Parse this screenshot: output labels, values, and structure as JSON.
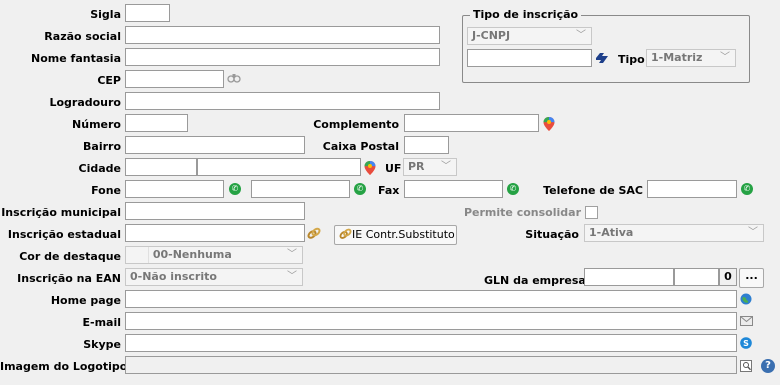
{
  "labels": {
    "sigla": "Sigla",
    "razao_social": "Razão social",
    "nome_fantasia": "Nome fantasia",
    "cep": "CEP",
    "logradouro": "Logradouro",
    "numero": "Número",
    "complemento": "Complemento",
    "bairro": "Bairro",
    "caixa_postal": "Caixa Postal",
    "cidade": "Cidade",
    "uf": "UF",
    "fone": "Fone",
    "fax": "Fax",
    "telefone_sac": "Telefone de SAC",
    "inscricao_municipal": "Inscrição municipal",
    "permite_consolidar": "Permite consolidar",
    "inscricao_estadual": "Inscrição estadual",
    "situacao": "Situação",
    "cor_destaque": "Cor de destaque",
    "inscricao_ean": "Inscrição na EAN",
    "gln_empresa": "GLN da empresa",
    "home_page": "Home page",
    "email": "E-mail",
    "skype": "Skype",
    "imagem_logotipo": "Imagem do Logotipo",
    "tipo_inscricao": "Tipo de inscrição",
    "tipo": "Tipo"
  },
  "values": {
    "tipo_inscricao": "J-CNPJ",
    "tipo": "1-Matriz",
    "uf": "PR",
    "situacao": "1-Ativa",
    "cor_destaque": "00-Nenhuma",
    "inscricao_ean": "0-Não inscrito",
    "gln_check_digit": "0"
  },
  "buttons": {
    "ie_contr_substituto": "IE Contr.Substituto",
    "gln_more": "...",
    "help": "?"
  },
  "icons": {
    "cep_lookup": "binoculars-icon",
    "map": "map-pin-icon",
    "whatsapp": "whatsapp-icon",
    "cnpj_lookup": "receita-federal-icon",
    "ie_link": "chain-link-icon",
    "globe": "globe-icon",
    "email": "envelope-icon",
    "skype": "skype-icon",
    "image": "image-icon",
    "help": "help-icon"
  },
  "colors": {
    "whatsapp": "#25a244",
    "map_pin": "#e84c3d",
    "skype": "#1e88d8",
    "help": "#3a6fb0"
  }
}
